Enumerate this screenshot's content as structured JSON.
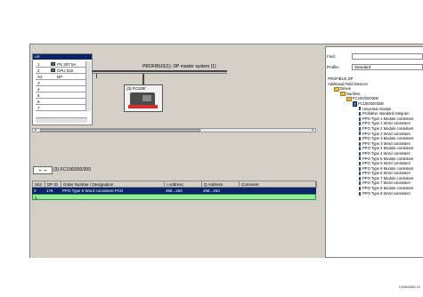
{
  "rack": {
    "title": "UR",
    "rows": [
      {
        "slot": "1",
        "module": "PS 307 5A",
        "icon": true
      },
      {
        "slot": "2",
        "module": "CPU 315",
        "icon": true
      },
      {
        "slot": "X2",
        "module": "DP",
        "icon": false
      },
      {
        "slot": "3",
        "module": "",
        "icon": false
      },
      {
        "slot": "4",
        "module": "",
        "icon": false
      },
      {
        "slot": "5",
        "module": "",
        "icon": false
      },
      {
        "slot": "6",
        "module": "",
        "icon": false
      },
      {
        "slot": "7",
        "module": "",
        "icon": false
      }
    ]
  },
  "network": {
    "bus_label": "PROFIBUS(1): DP master system (1)",
    "node_label": "(3) FC100/",
    "node_red_label": ""
  },
  "bottom": {
    "back_label": "⇐ ⇒",
    "header": "(3)   FC100/200/300",
    "columns": [
      "Slot",
      "DP ID",
      "Order Number / Designation",
      "I Address",
      "Q Address",
      "Comment"
    ],
    "rows": [
      {
        "slot": "0",
        "dpid": "175",
        "order": "PPO Type 6 Word consistent PCD",
        "iaddr": "256...263",
        "qaddr": "256...263",
        "comment": ""
      },
      {
        "slot": "1",
        "dpid": "",
        "order": "",
        "iaddr": "",
        "qaddr": "",
        "comment": ""
      }
    ]
  },
  "catalog": {
    "find_label": "Find:",
    "find_value": "",
    "profile_label": "Profile:",
    "profile_value": "Standard",
    "tree": [
      {
        "depth": 0,
        "kind": "text",
        "label": "PROFIBUS DP"
      },
      {
        "depth": 0,
        "kind": "text",
        "label": "Additional Field Devices"
      },
      {
        "depth": 1,
        "kind": "folder",
        "label": "Drives"
      },
      {
        "depth": 2,
        "kind": "folder",
        "label": "Danfoss"
      },
      {
        "depth": 3,
        "kind": "folder",
        "label": "FC100/200/300"
      },
      {
        "depth": 4,
        "kind": "dev",
        "label": "FC100/200/300"
      },
      {
        "depth": 5,
        "kind": "mod",
        "label": "Universal module"
      },
      {
        "depth": 5,
        "kind": "mod",
        "label": "Profidrive standard telegram"
      },
      {
        "depth": 5,
        "kind": "mod",
        "label": "PPO Type 1 Module consistent"
      },
      {
        "depth": 5,
        "kind": "mod",
        "label": "PPO Type 1 Word consistent"
      },
      {
        "depth": 5,
        "kind": "mod",
        "label": "PPO Type 2 Module consistent"
      },
      {
        "depth": 5,
        "kind": "mod",
        "label": "PPO Type 2 Word consistent"
      },
      {
        "depth": 5,
        "kind": "mod",
        "label": "PPO Type 3 Module consistent"
      },
      {
        "depth": 5,
        "kind": "mod",
        "label": "PPO Type 3 Word consistent"
      },
      {
        "depth": 5,
        "kind": "mod",
        "label": "PPO Type 4 Module consistent"
      },
      {
        "depth": 5,
        "kind": "mod",
        "label": "PPO Type 4 Word consistent"
      },
      {
        "depth": 5,
        "kind": "mod",
        "label": "PPO Type 5 Module consistent"
      },
      {
        "depth": 5,
        "kind": "mod",
        "label": "PPO Type 5 Word consistent"
      },
      {
        "depth": 5,
        "kind": "mod",
        "label": "PPO Type 6 Module consistent"
      },
      {
        "depth": 5,
        "kind": "mod",
        "label": "PPO Type 6 Word consistent"
      },
      {
        "depth": 5,
        "kind": "mod",
        "label": "PPO Type 7 Module consistent"
      },
      {
        "depth": 5,
        "kind": "mod",
        "label": "PPO Type 7 Word consistent"
      },
      {
        "depth": 5,
        "kind": "mod",
        "label": "PPO Type 8 Module consistent"
      },
      {
        "depth": 5,
        "kind": "mod",
        "label": "PPO Type 8 Word consistent"
      }
    ]
  },
  "figure_code": "130BA566.10",
  "colors": {
    "selection": "#0a246a",
    "green_row": "#90ee90",
    "bus_red": "#d32f2f"
  }
}
